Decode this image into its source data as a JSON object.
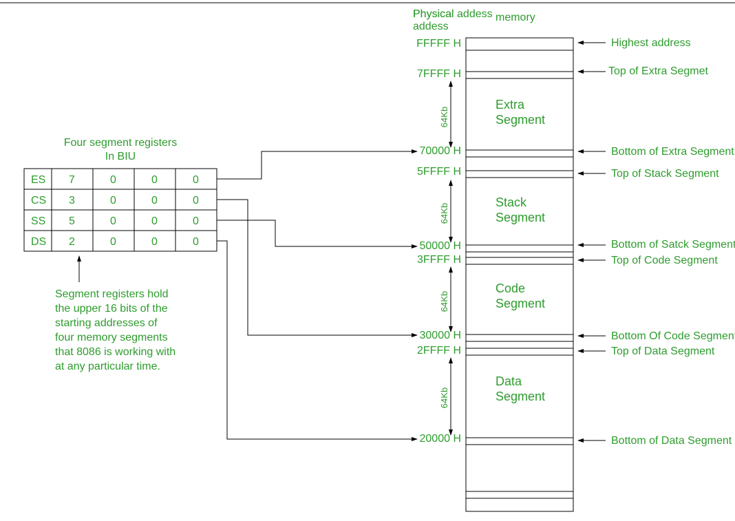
{
  "headers": {
    "physical": "Physical addess",
    "memory": "memory",
    "registers_title1": "Four segment registers",
    "registers_title2": "In BIU"
  },
  "registers": {
    "rows": [
      {
        "name": "ES",
        "d0": "7",
        "d1": "0",
        "d2": "0",
        "d3": "0"
      },
      {
        "name": "CS",
        "d0": "3",
        "d1": "0",
        "d2": "0",
        "d3": "0"
      },
      {
        "name": "SS",
        "d0": "5",
        "d1": "0",
        "d2": "0",
        "d3": "0"
      },
      {
        "name": "DS",
        "d0": "2",
        "d1": "0",
        "d2": "0",
        "d3": "0"
      }
    ]
  },
  "description": {
    "l1": "Segment registers hold",
    "l2": "the upper 16 bits of the",
    "l3": "starting addresses of",
    "l4": "four memory segments",
    "l5": "that 8086 is working with",
    "l6": "at any particular time."
  },
  "addresses": {
    "fffff": "FFFFF H",
    "a7ffff": "7FFFF H",
    "a70000": "70000 H",
    "a5ffff": "5FFFF H",
    "a50000": "50000 H",
    "a3ffff": "3FFFF H",
    "a30000": "30000 H",
    "a2ffff": "2FFFF H",
    "a20000": "20000 H"
  },
  "segments": {
    "extra1": "Extra",
    "extra2": "Segment",
    "stack1": "Stack",
    "stack2": "Segment",
    "code1": "Code",
    "code2": "Segment",
    "data1": "Data",
    "data2": "Segment"
  },
  "size_label": "64Kb",
  "pointers": {
    "highest": "Highest address",
    "top_extra": "Top of Extra Segmet",
    "bottom_extra": "Bottom of Extra Segment",
    "top_stack": "Top of Stack Segment",
    "bottom_stack": "Bottom of Satck Segment",
    "top_code": "Top of Code Segment",
    "bottom_code": "Bottom Of Code Segment",
    "top_data": "Top of Data Segment",
    "bottom_data": "Bottom of Data Segment"
  }
}
